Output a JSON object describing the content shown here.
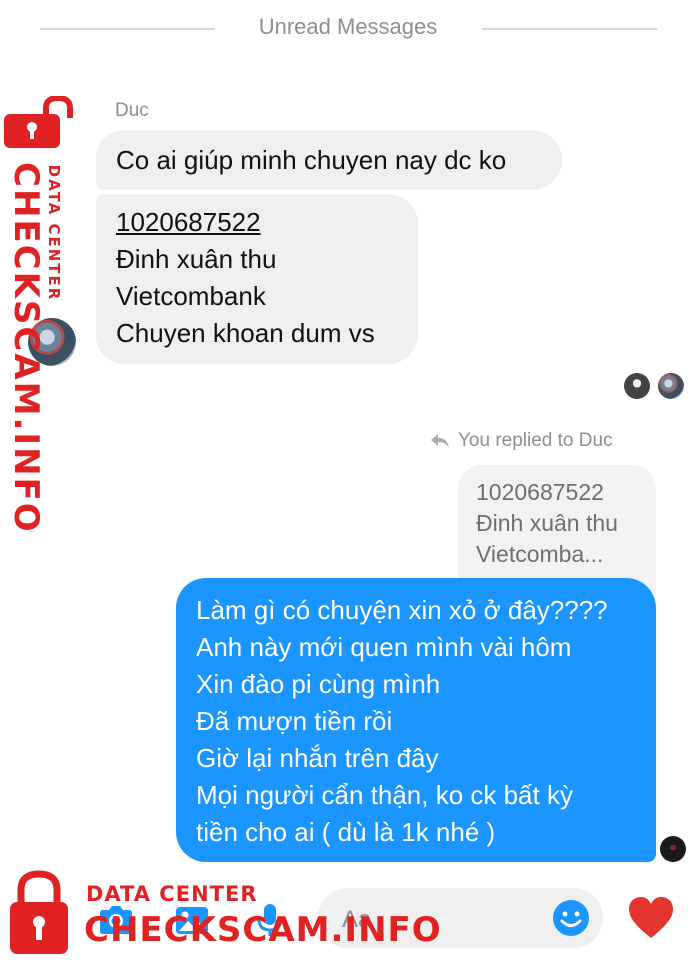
{
  "header": {
    "divider_label": "Unread Messages"
  },
  "incoming": {
    "sender_name": "Duc",
    "message_1": "Co ai giúp minh chuyen nay dc ko",
    "message_2_lines": [
      "1020687522",
      "Đinh xuân thu",
      "Vietcombank",
      "Chuyen khoan dum vs"
    ]
  },
  "reply": {
    "hint": "You replied to Duc",
    "quoted_lines": [
      "1020687522",
      "Đinh xuân thu",
      "Vietcomba..."
    ],
    "message_lines": [
      "Làm gì có chuyện xin xỏ ở đây????",
      "Anh này mới quen mình vài hôm",
      "Xin đào pi cùng mình",
      "Đã mượn tiền rồi",
      "Giờ lại nhắn trên đây",
      "Mọi người cẩn thận, ko ck bất kỳ",
      "tiền cho ai ( dù là 1k nhé )"
    ]
  },
  "composer": {
    "placeholder": "Aa",
    "icons": [
      "camera-icon",
      "photo-icon",
      "microphone-icon",
      "emoji-icon",
      "heart-icon"
    ]
  },
  "watermark": {
    "side_main": "CHECKSCAM.INFO",
    "side_sub": "DATA CENTER",
    "bottom_sub": "DATA CENTER",
    "bottom_main": "CHECKSCAM.INFO"
  },
  "colors": {
    "outgoing_bubble": "#1b95ff",
    "incoming_bubble": "#efefef",
    "watermark_red": "#e02222",
    "icon_blue": "#1b95ff",
    "heart_red": "#e3342f"
  }
}
